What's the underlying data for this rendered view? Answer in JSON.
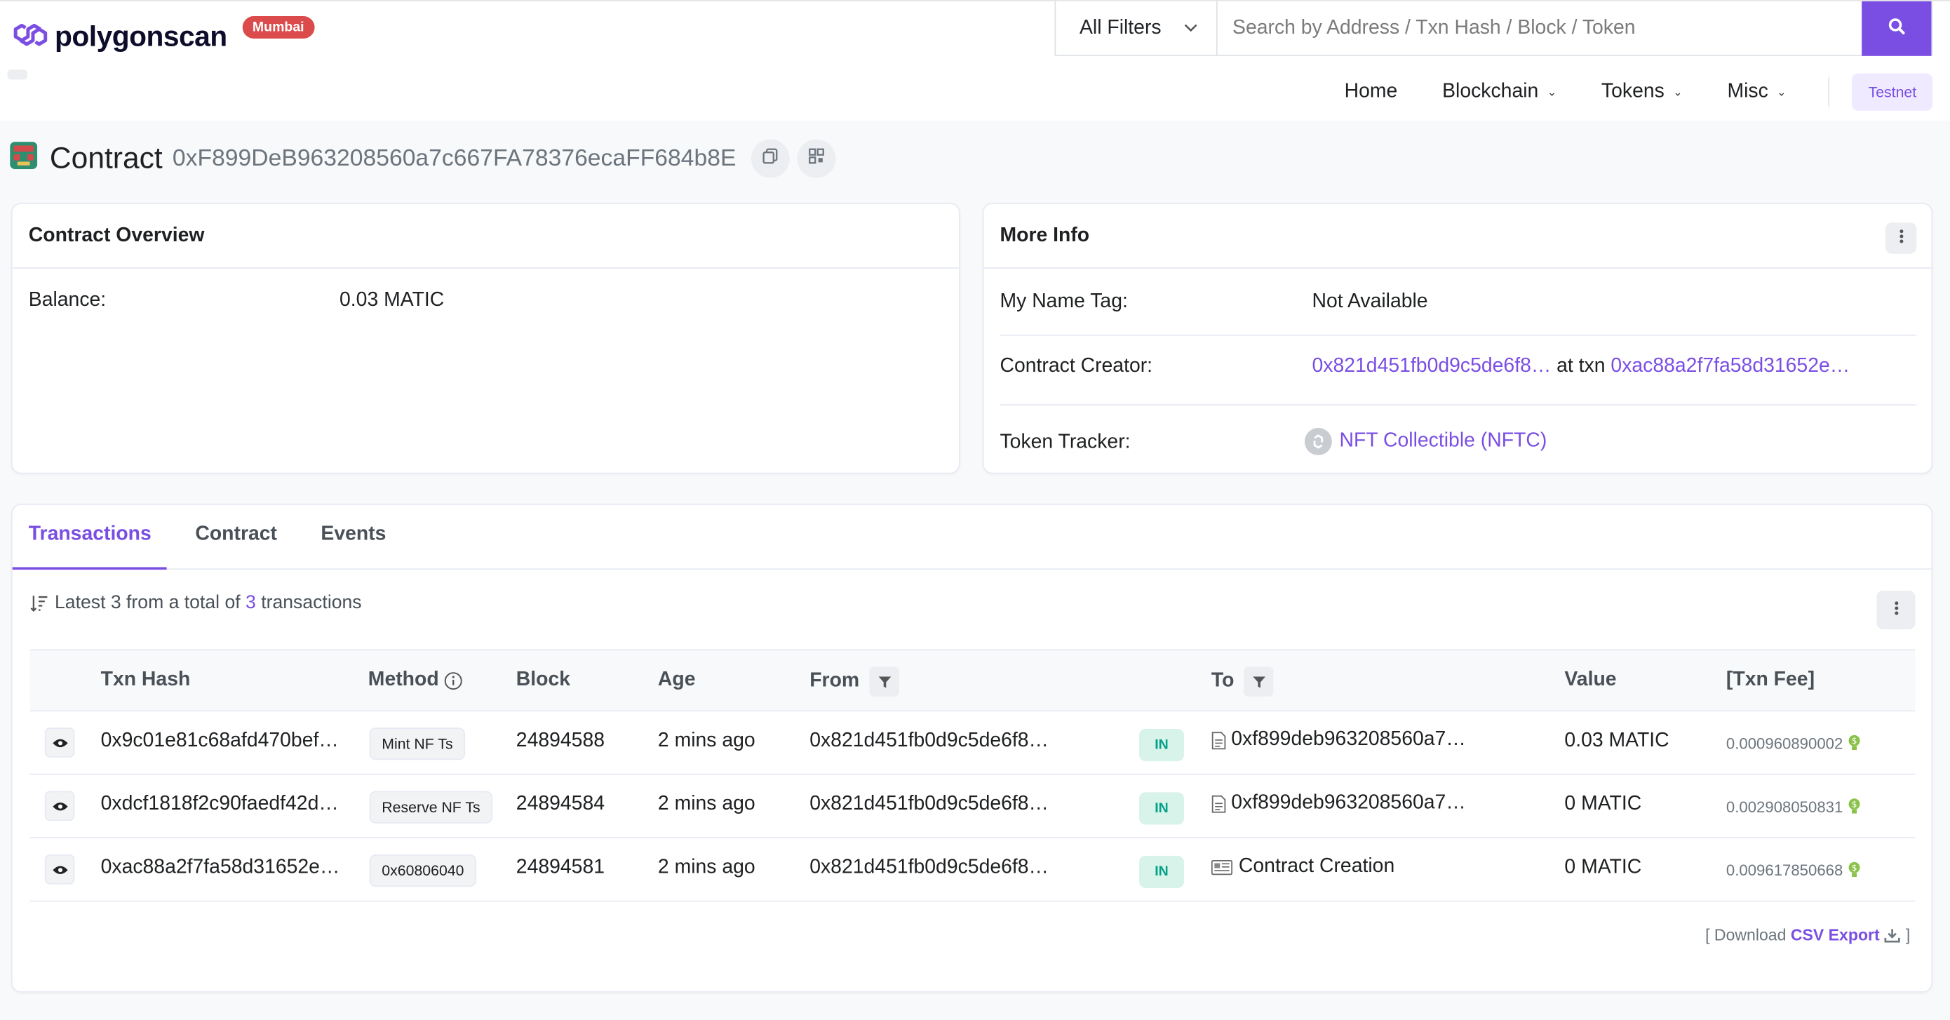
{
  "brand": {
    "name": "polygonscan",
    "network_badge": "Mumbai"
  },
  "search": {
    "filter_label": "All Filters",
    "placeholder": "Search by Address / Txn Hash / Block / Token"
  },
  "nav": {
    "home": "Home",
    "blockchain": "Blockchain",
    "tokens": "Tokens",
    "misc": "Misc",
    "testnet": "Testnet"
  },
  "contract": {
    "label": "Contract",
    "address": "0xF899DeB963208560a7c667FA78376ecaFF684b8E"
  },
  "overview": {
    "title": "Contract Overview",
    "balance_label": "Balance:",
    "balance_value": "0.03 MATIC"
  },
  "more_info": {
    "title": "More Info",
    "name_tag_label": "My Name Tag:",
    "name_tag_value": "Not Available",
    "creator_label": "Contract Creator:",
    "creator_address": "0x821d451fb0d9c5de6f8…",
    "creator_at_txn": "at txn",
    "creator_txn": "0xac88a2f7fa58d31652e…",
    "token_tracker_label": "Token Tracker:",
    "token_tracker_value": "NFT Collectible (NFTC)"
  },
  "tabs": [
    "Transactions",
    "Contract",
    "Events"
  ],
  "summary": {
    "prefix": "Latest 3 from a total of",
    "count": "3",
    "suffix": "transactions"
  },
  "table": {
    "headers": {
      "txn_hash": "Txn Hash",
      "method": "Method",
      "block": "Block",
      "age": "Age",
      "from": "From",
      "to": "To",
      "value": "Value",
      "fee": "[Txn Fee]"
    },
    "rows": [
      {
        "hash": "0x9c01e81c68afd470bef…",
        "method": "Mint NF Ts",
        "block": "24894588",
        "age": "2 mins ago",
        "from": "0x821d451fb0d9c5de6f8…",
        "direction": "IN",
        "to": "0xf899deb963208560a7…",
        "value": "0.03 MATIC",
        "fee": "0.000960890002"
      },
      {
        "hash": "0xdcf1818f2c90faedf42d…",
        "method": "Reserve NF Ts",
        "block": "24894584",
        "age": "2 mins ago",
        "from": "0x821d451fb0d9c5de6f8…",
        "direction": "IN",
        "to": "0xf899deb963208560a7…",
        "value": "0 MATIC",
        "fee": "0.002908050831"
      },
      {
        "hash": "0xac88a2f7fa58d31652e…",
        "method": "0x60806040",
        "block": "24894581",
        "age": "2 mins ago",
        "from": "0x821d451fb0d9c5de6f8…",
        "direction": "IN",
        "to": "Contract Creation",
        "value": "0 MATIC",
        "fee": "0.009617850668"
      }
    ]
  },
  "csv": {
    "prefix": "[ Download",
    "link": "CSV Export",
    "suffix": "]"
  },
  "colors": {
    "accent": "#7a4ee3",
    "badge_red": "#dc4b4b",
    "in_green": "#00a186"
  }
}
